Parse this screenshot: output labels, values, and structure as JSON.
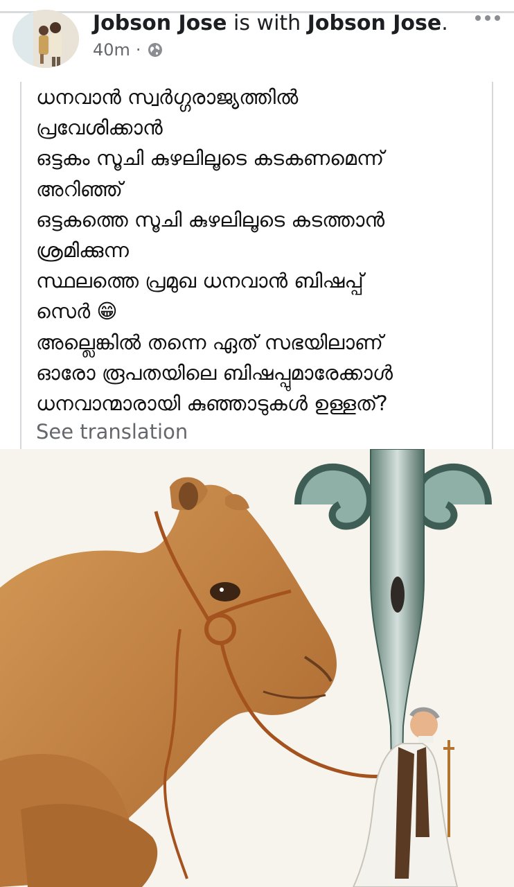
{
  "post": {
    "author": "Jobson Jose",
    "connector": "is with",
    "tagged": "Jobson Jose",
    "time": "40m",
    "privacy_icon": "globe-icon",
    "more_icon": "more-options-icon",
    "text": "ധനവാൻ സ്വർഗ്ഗരാജ്യത്തിൽ\nപ്രവേശിക്കാൻ\nഒട്ടകം സൂചി കുഴലിലൂടെ കടകണമെന്ന്\nഅറിഞ്ഞ്\nഒട്ടകത്തെ സൂചി കുഴലിലൂടെ കടത്താൻ\nശ്രമിക്കുന്ന\nസ്ഥലത്തെ പ്രമുഖ ധനവാൻ ബിഷപ്പ്\nസെർ 😁\nഅല്ലെങ്കിൽ തന്നെ ഏത് സഭയിലാണ്\nഓരോ രൂപതയിലെ ബിഷപ്പുമാരേക്കാൾ\nധനവാന്മാരായി കുഞ്ഞാടുകൾ ഉള്ളത്?",
    "see_translation": "See translation"
  },
  "colors": {
    "text": "#1c1e21",
    "secondary": "#65676b",
    "divider": "#d6d7da"
  }
}
